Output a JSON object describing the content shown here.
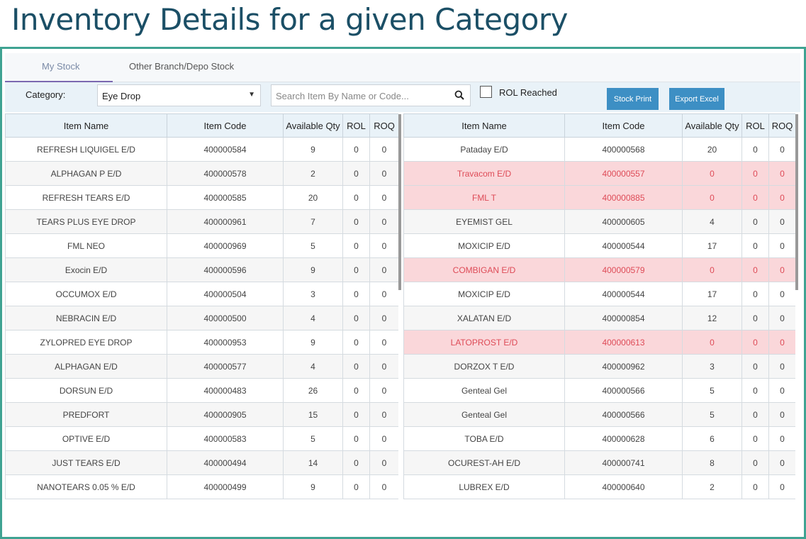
{
  "slide_title": "Inventory Details for a given Category",
  "tabs": [
    "My Stock",
    "Other Branch/Depo Stock"
  ],
  "filters": {
    "category_label": "Category:",
    "category_value": "Eye Drop",
    "search_placeholder": "Search Item By Name or Code...",
    "rol_reached_label": "ROL Reached",
    "rol_reached_checked": false
  },
  "buttons": {
    "stock_print": "Stock Print",
    "export_excel": "Export Excel"
  },
  "columns": [
    "Item Name",
    "Item Code",
    "Available Qty",
    "ROL",
    "ROQ"
  ],
  "colors": {
    "header_teal": "#1b4f66",
    "frame": "#3fa392",
    "button": "#3d8fc4",
    "highlight_bg": "#fad7da",
    "highlight_text": "#de4b57"
  },
  "left_rows": [
    {
      "name": "REFRESH LIQUIGEL E/D",
      "code": "400000584",
      "qty": "9",
      "rol": "0",
      "roq": "0",
      "highlight": false
    },
    {
      "name": "ALPHAGAN P E/D",
      "code": "400000578",
      "qty": "2",
      "rol": "0",
      "roq": "0",
      "highlight": false
    },
    {
      "name": "REFRESH TEARS E/D",
      "code": "400000585",
      "qty": "20",
      "rol": "0",
      "roq": "0",
      "highlight": false
    },
    {
      "name": "TEARS PLUS EYE DROP",
      "code": "400000961",
      "qty": "7",
      "rol": "0",
      "roq": "0",
      "highlight": false
    },
    {
      "name": "FML NEO",
      "code": "400000969",
      "qty": "5",
      "rol": "0",
      "roq": "0",
      "highlight": false
    },
    {
      "name": "Exocin E/D",
      "code": "400000596",
      "qty": "9",
      "rol": "0",
      "roq": "0",
      "highlight": false
    },
    {
      "name": "OCCUMOX E/D",
      "code": "400000504",
      "qty": "3",
      "rol": "0",
      "roq": "0",
      "highlight": false
    },
    {
      "name": "NEBRACIN E/D",
      "code": "400000500",
      "qty": "4",
      "rol": "0",
      "roq": "0",
      "highlight": false
    },
    {
      "name": "ZYLOPRED EYE DROP",
      "code": "400000953",
      "qty": "9",
      "rol": "0",
      "roq": "0",
      "highlight": false
    },
    {
      "name": "ALPHAGAN E/D",
      "code": "400000577",
      "qty": "4",
      "rol": "0",
      "roq": "0",
      "highlight": false
    },
    {
      "name": "DORSUN E/D",
      "code": "400000483",
      "qty": "26",
      "rol": "0",
      "roq": "0",
      "highlight": false
    },
    {
      "name": "PREDFORT",
      "code": "400000905",
      "qty": "15",
      "rol": "0",
      "roq": "0",
      "highlight": false
    },
    {
      "name": "OPTIVE E/D",
      "code": "400000583",
      "qty": "5",
      "rol": "0",
      "roq": "0",
      "highlight": false
    },
    {
      "name": "JUST TEARS E/D",
      "code": "400000494",
      "qty": "14",
      "rol": "0",
      "roq": "0",
      "highlight": false
    },
    {
      "name": "NANOTEARS 0.05 % E/D",
      "code": "400000499",
      "qty": "9",
      "rol": "0",
      "roq": "0",
      "highlight": false
    }
  ],
  "right_rows": [
    {
      "name": "Pataday E/D",
      "code": "400000568",
      "qty": "20",
      "rol": "0",
      "roq": "0",
      "highlight": false
    },
    {
      "name": "Travacom E/D",
      "code": "400000557",
      "qty": "0",
      "rol": "0",
      "roq": "0",
      "highlight": true
    },
    {
      "name": "FML T",
      "code": "400000885",
      "qty": "0",
      "rol": "0",
      "roq": "0",
      "highlight": true
    },
    {
      "name": "EYEMIST GEL",
      "code": "400000605",
      "qty": "4",
      "rol": "0",
      "roq": "0",
      "highlight": false
    },
    {
      "name": "MOXICIP E/D",
      "code": "400000544",
      "qty": "17",
      "rol": "0",
      "roq": "0",
      "highlight": false
    },
    {
      "name": "COMBIGAN E/D",
      "code": "400000579",
      "qty": "0",
      "rol": "0",
      "roq": "0",
      "highlight": true
    },
    {
      "name": "MOXICIP E/D",
      "code": "400000544",
      "qty": "17",
      "rol": "0",
      "roq": "0",
      "highlight": false
    },
    {
      "name": "XALATAN E/D",
      "code": "400000854",
      "qty": "12",
      "rol": "0",
      "roq": "0",
      "highlight": false
    },
    {
      "name": "LATOPROST E/D",
      "code": "400000613",
      "qty": "0",
      "rol": "0",
      "roq": "0",
      "highlight": true
    },
    {
      "name": "DORZOX T E/D",
      "code": "400000962",
      "qty": "3",
      "rol": "0",
      "roq": "0",
      "highlight": false
    },
    {
      "name": "Genteal Gel",
      "code": "400000566",
      "qty": "5",
      "rol": "0",
      "roq": "0",
      "highlight": false
    },
    {
      "name": "Genteal Gel",
      "code": "400000566",
      "qty": "5",
      "rol": "0",
      "roq": "0",
      "highlight": false
    },
    {
      "name": "TOBA E/D",
      "code": "400000628",
      "qty": "6",
      "rol": "0",
      "roq": "0",
      "highlight": false
    },
    {
      "name": "OCUREST-AH E/D",
      "code": "400000741",
      "qty": "8",
      "rol": "0",
      "roq": "0",
      "highlight": false
    },
    {
      "name": "LUBREX E/D",
      "code": "400000640",
      "qty": "2",
      "rol": "0",
      "roq": "0",
      "highlight": false
    }
  ]
}
